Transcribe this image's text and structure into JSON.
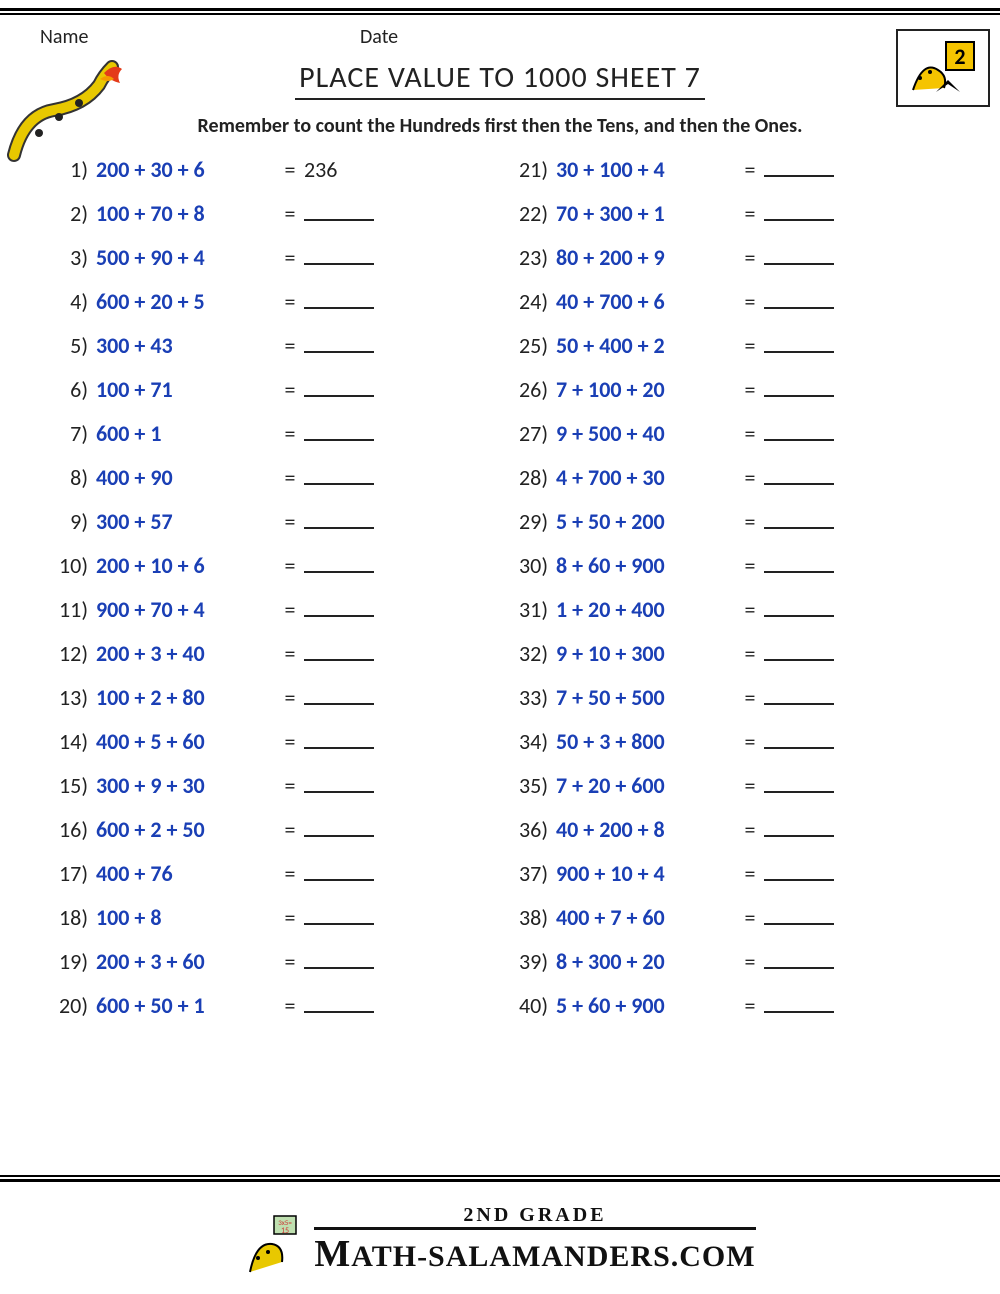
{
  "header": {
    "name_label": "Name",
    "date_label": "Date"
  },
  "title": "PLACE VALUE TO 1000 SHEET 7",
  "instruction": "Remember to count the Hundreds first then the Tens, and then the Ones.",
  "left": [
    {
      "n": "1)",
      "e": "200 + 30 + 6",
      "a": "236"
    },
    {
      "n": "2)",
      "e": "100 + 70 + 8",
      "a": ""
    },
    {
      "n": "3)",
      "e": "500 + 90 + 4",
      "a": ""
    },
    {
      "n": "4)",
      "e": "600 + 20 + 5",
      "a": ""
    },
    {
      "n": "5)",
      "e": "300 + 43",
      "a": ""
    },
    {
      "n": "6)",
      "e": "100 + 71",
      "a": ""
    },
    {
      "n": "7)",
      "e": "600 + 1",
      "a": ""
    },
    {
      "n": "8)",
      "e": "400 + 90",
      "a": ""
    },
    {
      "n": "9)",
      "e": "300 + 57",
      "a": ""
    },
    {
      "n": "10)",
      "e": "200 + 10 + 6",
      "a": ""
    },
    {
      "n": "11)",
      "e": "900 + 70 + 4",
      "a": ""
    },
    {
      "n": "12)",
      "e": "200 + 3 + 40",
      "a": ""
    },
    {
      "n": "13)",
      "e": "100 + 2 + 80",
      "a": ""
    },
    {
      "n": "14)",
      "e": "400 + 5 + 60",
      "a": ""
    },
    {
      "n": "15)",
      "e": "300 + 9 + 30",
      "a": ""
    },
    {
      "n": "16)",
      "e": "600 + 2 + 50",
      "a": ""
    },
    {
      "n": "17)",
      "e": "400 + 76",
      "a": ""
    },
    {
      "n": "18)",
      "e": "100 + 8",
      "a": ""
    },
    {
      "n": "19)",
      "e": "200 + 3 + 60",
      "a": ""
    },
    {
      "n": "20)",
      "e": "600 + 50 + 1",
      "a": ""
    }
  ],
  "right": [
    {
      "n": "21)",
      "e": "30 + 100 + 4",
      "a": ""
    },
    {
      "n": "22)",
      "e": "70 + 300 + 1",
      "a": ""
    },
    {
      "n": "23)",
      "e": "80 + 200 + 9",
      "a": ""
    },
    {
      "n": "24)",
      "e": "40 + 700 + 6",
      "a": ""
    },
    {
      "n": "25)",
      "e": "50 + 400 + 2",
      "a": ""
    },
    {
      "n": "26)",
      "e": "7 + 100 + 20",
      "a": ""
    },
    {
      "n": "27)",
      "e": "9 + 500 + 40",
      "a": ""
    },
    {
      "n": "28)",
      "e": "4 + 700 + 30",
      "a": ""
    },
    {
      "n": "29)",
      "e": "5 + 50 + 200",
      "a": ""
    },
    {
      "n": "30)",
      "e": "8 + 60 + 900",
      "a": ""
    },
    {
      "n": "31)",
      "e": "1 + 20 + 400",
      "a": ""
    },
    {
      "n": "32)",
      "e": "9 + 10 + 300",
      "a": ""
    },
    {
      "n": "33)",
      "e": "7 + 50 + 500",
      "a": ""
    },
    {
      "n": "34)",
      "e": "50 + 3 + 800",
      "a": ""
    },
    {
      "n": "35)",
      "e": "7 + 20 + 600",
      "a": ""
    },
    {
      "n": "36)",
      "e": "40 + 200 + 8",
      "a": ""
    },
    {
      "n": "37)",
      "e": "900 + 10 + 4",
      "a": ""
    },
    {
      "n": "38)",
      "e": "400 + 7 + 60",
      "a": ""
    },
    {
      "n": "39)",
      "e": "8 + 300 + 20",
      "a": ""
    },
    {
      "n": "40)",
      "e": "5 + 60 + 900",
      "a": ""
    }
  ],
  "eq": "=",
  "footer": {
    "grade": "2ND GRADE",
    "site_prefix": "ATH-SALAMANDERS.COM"
  },
  "icons": {
    "logo": "grade-2-salamander-logo",
    "mascot": "fire-salamander-icon"
  }
}
